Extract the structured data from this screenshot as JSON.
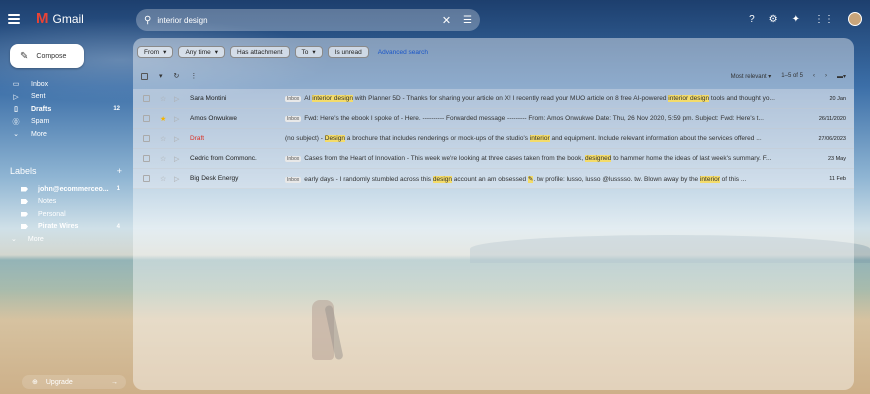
{
  "app": {
    "name": "Gmail"
  },
  "search": {
    "query": "interior design"
  },
  "compose": {
    "label": "Compose"
  },
  "nav": [
    {
      "label": "Inbox",
      "icon": "inbox-icon",
      "glyph": "▭",
      "count": "",
      "bold": false
    },
    {
      "label": "Sent",
      "icon": "send-icon",
      "glyph": "▷",
      "count": "",
      "bold": false
    },
    {
      "label": "Drafts",
      "icon": "draft-icon",
      "glyph": "▯",
      "count": "12",
      "bold": true
    },
    {
      "label": "Spam",
      "icon": "spam-icon",
      "glyph": "⓪",
      "count": "",
      "bold": false
    },
    {
      "label": "More",
      "icon": "chevron-down-icon",
      "glyph": "⌄",
      "count": "",
      "bold": false
    }
  ],
  "labels": {
    "heading": "Labels",
    "add": "+",
    "items": [
      {
        "label": "john@ecommerceo...",
        "count": "1",
        "bold": true
      },
      {
        "label": "Notes",
        "count": "",
        "bold": false
      },
      {
        "label": "Personal",
        "count": "",
        "bold": false
      },
      {
        "label": "Pirate Wires",
        "count": "4",
        "bold": true
      },
      {
        "label": "More",
        "count": "",
        "bold": false,
        "chevron": true
      }
    ]
  },
  "upgrade": {
    "label": "Upgrade"
  },
  "filters": {
    "chips": [
      "From",
      "Any time",
      "Has attachment",
      "To",
      "Is unread"
    ],
    "chip_has_dropdown": [
      true,
      true,
      false,
      true,
      false
    ],
    "advanced": "Advanced search"
  },
  "toolbar": {
    "sort": "Most relevant",
    "range": "1–5 of 5"
  },
  "emails": [
    {
      "sender": "Sara Montini",
      "draft": false,
      "starred": false,
      "inbox_tag": "Inbox",
      "segments": [
        {
          "t": "AI ",
          "h": false
        },
        {
          "t": "interior design",
          "h": true
        },
        {
          "t": " with Planner 5D - Thanks for sharing your article on X! I recently read your MUO article on 8 free AI-powered ",
          "h": false
        },
        {
          "t": "interior design",
          "h": true
        },
        {
          "t": " tools and thought yo...",
          "h": false
        }
      ],
      "date": "20 Jan"
    },
    {
      "sender": "Amos Onwukwe",
      "draft": false,
      "starred": true,
      "inbox_tag": "Inbox",
      "segments": [
        {
          "t": "Fwd: Here's the ebook I spoke of - Here. ---------- Forwarded message --------- From: Amos Onwukwe Date: Thu, 26 Nov 2020, 5:59 pm. Subject: Fwd: Here's t...",
          "h": false
        }
      ],
      "date": "26/11/2020"
    },
    {
      "sender": "Draft",
      "draft": true,
      "starred": false,
      "inbox_tag": "",
      "segments": [
        {
          "t": "(no subject) - ",
          "h": false
        },
        {
          "t": "Design",
          "h": true
        },
        {
          "t": " a brochure that includes renderings or mock-ups of the studio's ",
          "h": false
        },
        {
          "t": "interior",
          "h": true
        },
        {
          "t": " and equipment. Include relevant information about the services offered ...",
          "h": false
        }
      ],
      "date": "27/06/2023"
    },
    {
      "sender": "Cedric from Commonc.",
      "draft": false,
      "starred": false,
      "inbox_tag": "Inbox",
      "segments": [
        {
          "t": "Cases from the Heart of Innovation - This week we're looking at three cases taken from the book, ",
          "h": false
        },
        {
          "t": "designed",
          "h": true
        },
        {
          "t": " to hammer home the ideas of last week's summary. F...",
          "h": false
        }
      ],
      "date": "23 May"
    },
    {
      "sender": "Big Desk Energy",
      "draft": false,
      "starred": false,
      "inbox_tag": "Inbox",
      "segments": [
        {
          "t": "early days - I randomly stumbled across this ",
          "h": false
        },
        {
          "t": "design",
          "h": true
        },
        {
          "t": " account an am obsessed ",
          "h": false
        },
        {
          "t": "✎",
          "h": true
        },
        {
          "t": ". tw profile: lusso, lusso @lusssso. tw. Blown away by the ",
          "h": false
        },
        {
          "t": "interior",
          "h": true
        },
        {
          "t": " of this ...",
          "h": false
        }
      ],
      "date": "11 Feb"
    }
  ]
}
